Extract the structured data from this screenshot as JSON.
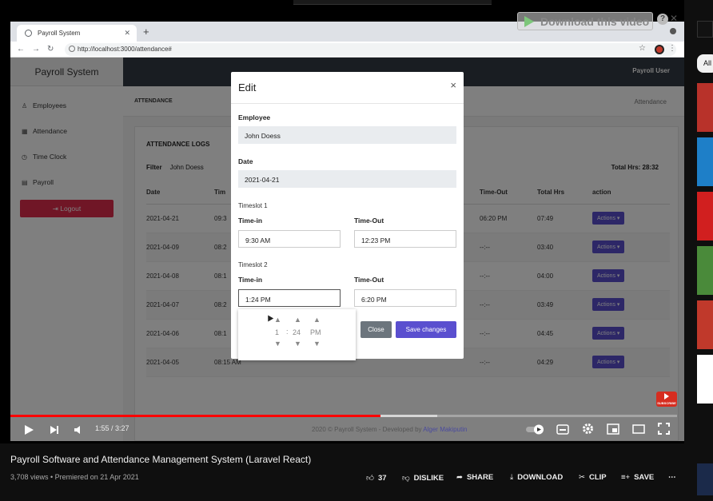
{
  "browser": {
    "tab_title": "Payroll System",
    "url": "http://localhost:3000/attendance#"
  },
  "app": {
    "brand": "Payroll System",
    "user": "Payroll User",
    "sidebar": [
      {
        "label": "Employees",
        "icon": "person-icon"
      },
      {
        "label": "Attendance",
        "icon": "calendar-icon"
      },
      {
        "label": "Time Clock",
        "icon": "clock-icon"
      },
      {
        "label": "Payroll",
        "icon": "document-icon"
      }
    ],
    "logout_label": "Logout",
    "breadcrumb": "ATTENDANCE",
    "breadcrumb_right": "Attendance",
    "card_title": "ATTENDANCE LOGS",
    "filter_label": "Filter",
    "filter_value": "John Doess",
    "total_hrs": "Total Hrs: 28:32",
    "table": {
      "headers": [
        "Date",
        "Tim",
        "Time-Out",
        "Total Hrs",
        "action"
      ],
      "rows": [
        {
          "date": "2021-04-21",
          "tin": "09:3",
          "tout": "06:20 PM",
          "total": "07:49"
        },
        {
          "date": "2021-04-09",
          "tin": "08:2",
          "tout": "--:--",
          "total": "03:40"
        },
        {
          "date": "2021-04-08",
          "tin": "08:1",
          "tout": "--:--",
          "total": "04:00"
        },
        {
          "date": "2021-04-07",
          "tin": "08:2",
          "tout": "--:--",
          "total": "03:49"
        },
        {
          "date": "2021-04-06",
          "tin": "08:1",
          "tout": "--:--",
          "total": "04:45"
        },
        {
          "date": "2021-04-05",
          "tin": "08:15 AM",
          "tout": "--:--",
          "total": "04:29"
        }
      ],
      "action_label": "Actions"
    }
  },
  "modal": {
    "title": "Edit",
    "close_glyph": "×",
    "employee_label": "Employee",
    "employee_value": "John Doess",
    "date_label": "Date",
    "date_value": "2021-04-21",
    "timeslot1": "Timeslot 1",
    "timeslot2": "Timeslot 2",
    "timein_label": "Time-in",
    "timeout_label": "Time-Out",
    "ts1_in": "9:30 AM",
    "ts1_out": "12:23 PM",
    "ts2_in": "1:24 PM",
    "ts2_out": "6:20 PM",
    "picker": {
      "hour": "1",
      "sep": ":",
      "minute": "24",
      "ampm": "PM"
    },
    "close_button": "Close",
    "save_button": "Save changes"
  },
  "overlay_ext": {
    "download_label": "Download this video",
    "help": "?",
    "close": "✕"
  },
  "player": {
    "time": "1:55 / 3:27",
    "played_fraction": 0.555,
    "buffered_fraction": 0.64,
    "credits_prefix": "2020 © Payroll System - Developed by ",
    "credits_author": "Alger Makiputin",
    "subscribe": "SUBSCRIBE"
  },
  "video": {
    "title": "Payroll Software and Attendance Management System (Laravel React)",
    "meta": "3,708 views • Premiered on 21 Apr 2021",
    "likes": "37",
    "dislike": "DISLIKE",
    "share": "SHARE",
    "download": "DOWNLOAD",
    "clip": "CLIP",
    "save": "SAVE"
  },
  "rail": {
    "chip": "All"
  }
}
